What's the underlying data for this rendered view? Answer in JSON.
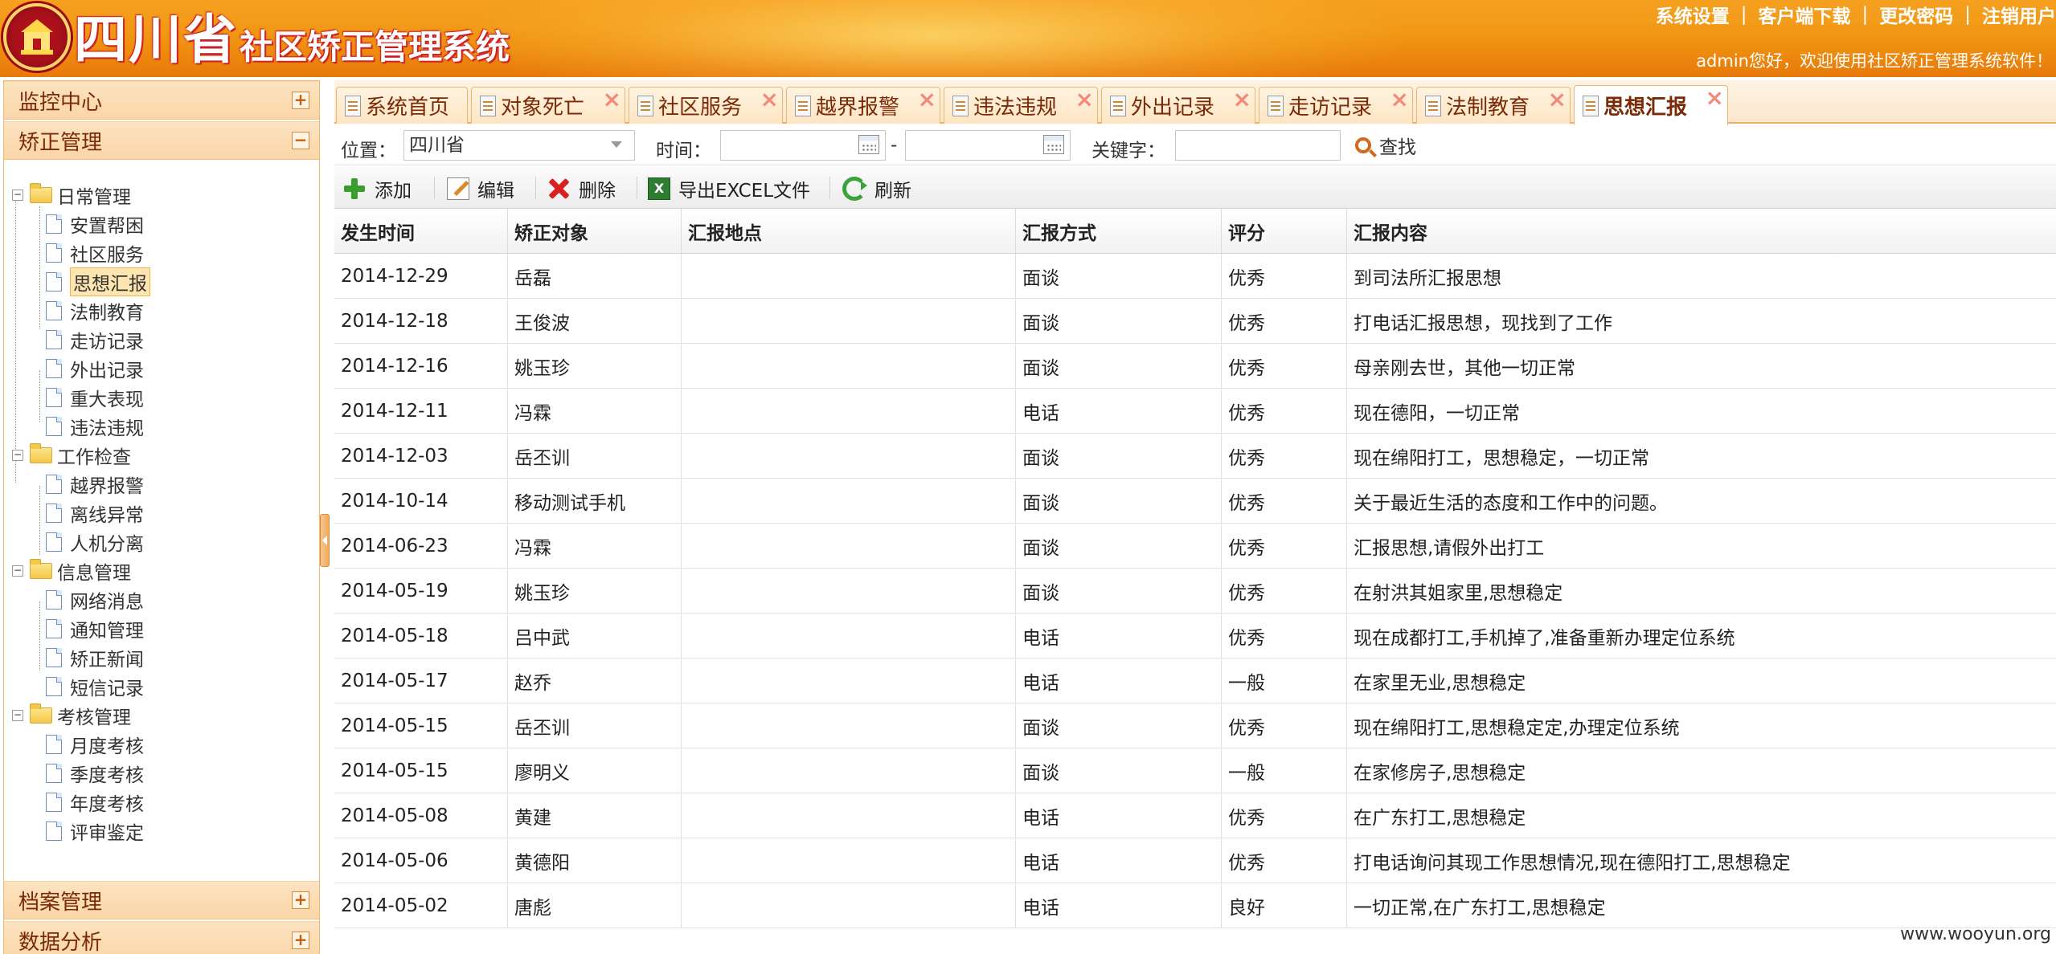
{
  "header": {
    "title_big": "四川省",
    "title_small": "社区矫正管理系统",
    "links": [
      "系统设置",
      "客户端下载",
      "更改密码",
      "注销用户"
    ],
    "welcome": "admin您好，欢迎使用社区矫正管理系统软件！"
  },
  "sidebar": {
    "top_sections": [
      {
        "label": "监控中心",
        "toggle": "+"
      },
      {
        "label": "矫正管理",
        "toggle": "−"
      }
    ],
    "bottom_sections": [
      {
        "label": "档案管理",
        "toggle": "+"
      },
      {
        "label": "数据分析",
        "toggle": "+"
      }
    ],
    "tree": [
      {
        "label": "日常管理",
        "children": [
          "安置帮困",
          "社区服务",
          "思想汇报",
          "法制教育",
          "走访记录",
          "外出记录",
          "重大表现",
          "违法违规"
        ]
      },
      {
        "label": "工作检查",
        "children": [
          "越界报警",
          "离线异常",
          "人机分离"
        ]
      },
      {
        "label": "信息管理",
        "children": [
          "网络消息",
          "通知管理",
          "矫正新闻",
          "短信记录"
        ]
      },
      {
        "label": "考核管理",
        "children": [
          "月度考核",
          "季度考核",
          "年度考核",
          "评审鉴定"
        ]
      }
    ],
    "selected": "思想汇报"
  },
  "tabs": [
    "系统首页",
    "对象死亡",
    "社区服务",
    "越界报警",
    "违法违规",
    "外出记录",
    "走访记录",
    "法制教育",
    "思想汇报"
  ],
  "active_tab": "思想汇报",
  "search": {
    "location_label": "位置：",
    "location_value": "四川省",
    "time_label": "时间：",
    "dash": "-",
    "keyword_label": "关键字：",
    "search_button": "查找"
  },
  "toolbar": {
    "add": "添加",
    "edit": "编辑",
    "delete": "删除",
    "export": "导出EXCEL文件",
    "refresh": "刷新"
  },
  "table": {
    "columns": [
      "发生时间",
      "矫正对象",
      "汇报地点",
      "汇报方式",
      "评分",
      "汇报内容"
    ],
    "rows": [
      [
        "2014-12-29",
        "岳磊",
        "",
        "面谈",
        "优秀",
        "到司法所汇报思想"
      ],
      [
        "2014-12-18",
        "王俊波",
        "",
        "面谈",
        "优秀",
        "打电话汇报思想，现找到了工作"
      ],
      [
        "2014-12-16",
        "姚玉珍",
        "",
        "面谈",
        "优秀",
        "母亲刚去世，其他一切正常"
      ],
      [
        "2014-12-11",
        "冯霖",
        "",
        "电话",
        "优秀",
        "现在德阳，一切正常"
      ],
      [
        "2014-12-03",
        "岳丕训",
        "",
        "面谈",
        "优秀",
        "现在绵阳打工，思想稳定，一切正常"
      ],
      [
        "2014-10-14",
        "移动测试手机",
        "",
        "面谈",
        "优秀",
        "关于最近生活的态度和工作中的问题。"
      ],
      [
        "2014-06-23",
        "冯霖",
        "",
        "面谈",
        "优秀",
        "汇报思想,请假外出打工"
      ],
      [
        "2014-05-19",
        "姚玉珍",
        "",
        "面谈",
        "优秀",
        "在射洪其姐家里,思想稳定"
      ],
      [
        "2014-05-18",
        "吕中武",
        "",
        "电话",
        "优秀",
        "现在成都打工,手机掉了,准备重新办理定位系统"
      ],
      [
        "2014-05-17",
        "赵乔",
        "",
        "电话",
        "一般",
        "在家里无业,思想稳定"
      ],
      [
        "2014-05-15",
        "岳丕训",
        "",
        "面谈",
        "优秀",
        "现在绵阳打工,思想稳定定,办理定位系统"
      ],
      [
        "2014-05-15",
        "廖明义",
        "",
        "面谈",
        "一般",
        "在家修房子,思想稳定"
      ],
      [
        "2014-05-08",
        "黄建",
        "",
        "电话",
        "优秀",
        "在广东打工,思想稳定"
      ],
      [
        "2014-05-06",
        "黄德阳",
        "",
        "电话",
        "优秀",
        "打电话询问其现工作思想情况,现在德阳打工,思想稳定"
      ],
      [
        "2014-05-02",
        "唐彪",
        "",
        "电话",
        "良好",
        "一切正常,在广东打工,思想稳定"
      ]
    ]
  },
  "watermark": "www.wooyun.org"
}
